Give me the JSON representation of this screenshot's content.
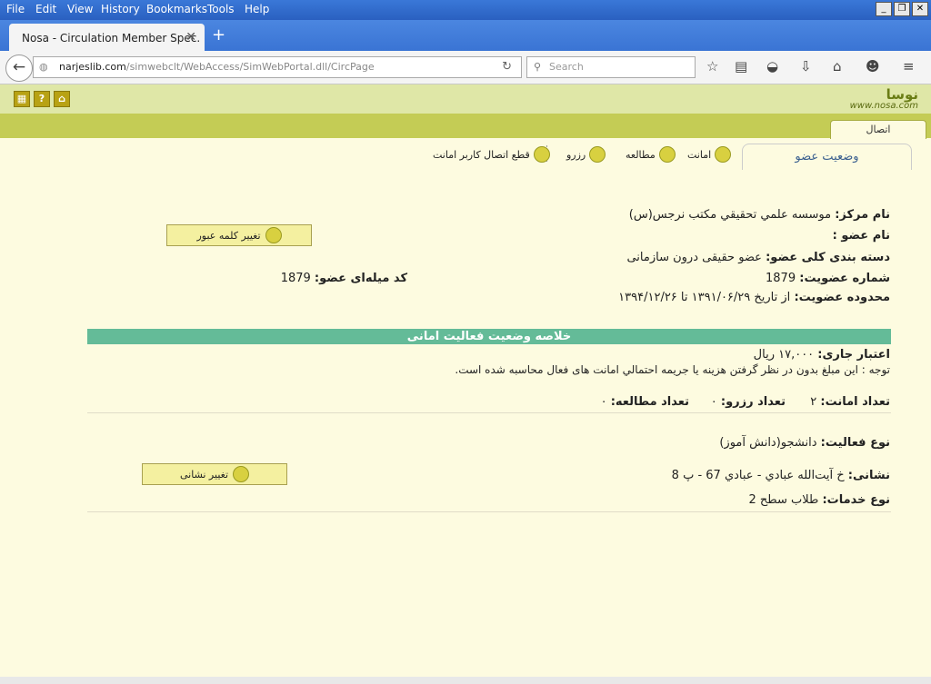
{
  "menu": [
    "File",
    "Edit",
    "View",
    "History",
    "Bookmarks",
    "Tools",
    "Help"
  ],
  "tab": {
    "title": "Nosa - Circulation Member Spec."
  },
  "nav": {
    "url_host": "narjeslib.com",
    "url_path": "/simwebclt/WebAccess/SimWebPortal.dll/CircPage",
    "search_placeholder": "Search"
  },
  "site": {
    "logo_text": "نوسا",
    "logo_url": "www.nosa.com",
    "connection_tab": "اتصال"
  },
  "tabs": {
    "member_status": "وضعیت عضو"
  },
  "actions": {
    "loan": "امانت",
    "study": "مطالعه",
    "reserve": "رزرو",
    "disconnect": "قطع اتصال کاربر امانت"
  },
  "member": {
    "center_label": "نام مرکز:",
    "center_value": "موسسه علمي تحقيقي مکتب نرجس(س)",
    "name_label": "نام عضو :",
    "name_value": "",
    "category_label": "دسته بندی کلی عضو:",
    "category_value": "عضو حقیقی درون سازمانی",
    "number_label": "شماره عضویت:",
    "number_value": "1879",
    "barcode_label": "کد میله‌ای عضو:",
    "barcode_value": "1879",
    "range_label": "محدوده عضویت:",
    "range_value": "از تاریخ ۱۳۹۱/۰۶/۲۹ تا ۱۳۹۴/۱۲/۲۶",
    "change_password": "تغییر کلمه عبور"
  },
  "summary": {
    "title": "خلاصه وضعیت فعالیت امانی",
    "credit_label": "اعتبار جاری:",
    "credit_value": "۱۷,۰۰۰ ریال",
    "note": "توجه : این مبلغ بدون در نظر گرفتن هزینه یا جریمه احتمالي امانت های فعال محاسبه شده است.",
    "loans_label": "تعداد امانت:",
    "loans_value": "۲",
    "reserves_label": "تعداد رزرو:",
    "reserves_value": "۰",
    "studies_label": "تعداد مطالعه:",
    "studies_value": "۰"
  },
  "activity": {
    "type_label": "نوع فعالیت:",
    "type_value": "دانشجو(دانش آموز)",
    "address_label": "نشانی:",
    "address_value": "خ آیت‌الله عبادي - عبادي 67 - پ 8",
    "service_label": "نوع خدمات:",
    "service_value": "طلاب سطح 2",
    "change_address": "تغییر نشانی"
  }
}
